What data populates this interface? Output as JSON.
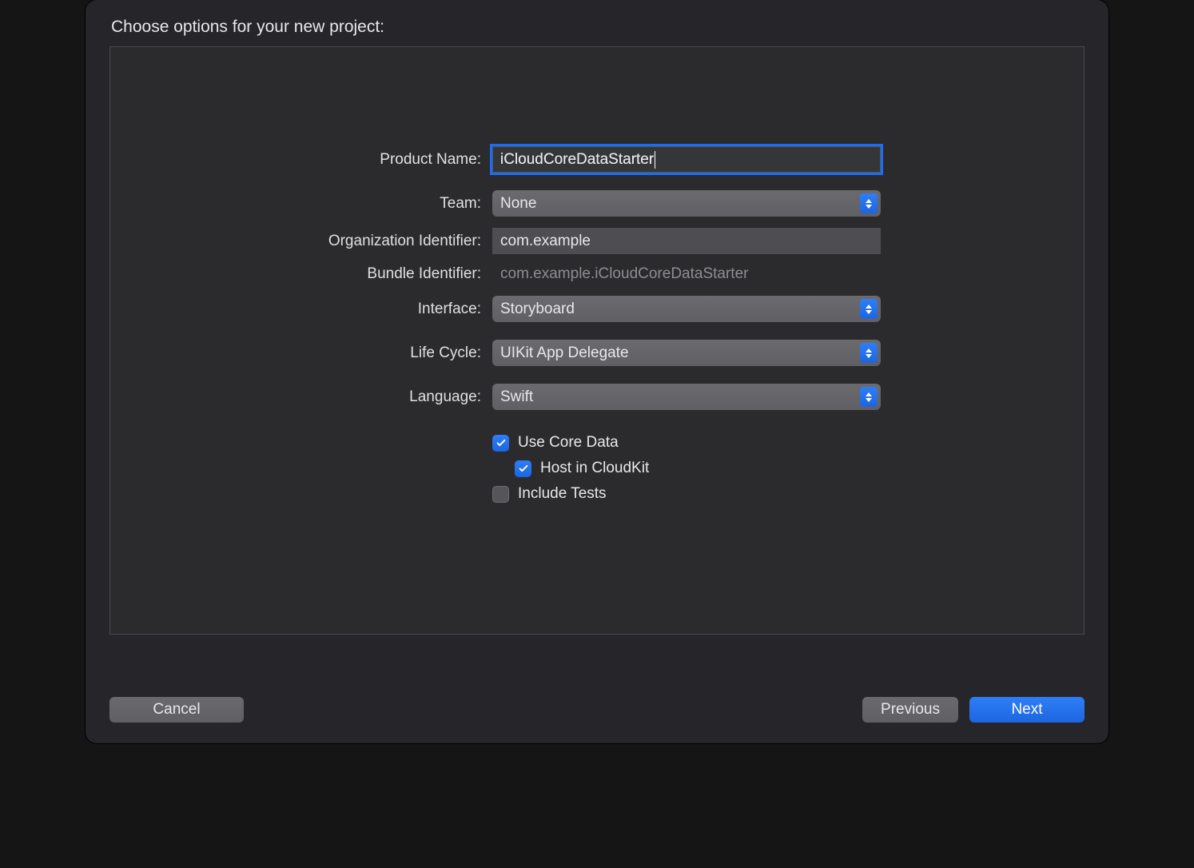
{
  "heading": "Choose options for your new project:",
  "fields": {
    "product_name": {
      "label": "Product Name:",
      "value": "iCloudCoreDataStarter"
    },
    "team": {
      "label": "Team:",
      "value": "None"
    },
    "org_identifier": {
      "label": "Organization Identifier:",
      "value": "com.example"
    },
    "bundle_identifier": {
      "label": "Bundle Identifier:",
      "value": "com.example.iCloudCoreDataStarter"
    },
    "interface": {
      "label": "Interface:",
      "value": "Storyboard"
    },
    "life_cycle": {
      "label": "Life Cycle:",
      "value": "UIKit App Delegate"
    },
    "language": {
      "label": "Language:",
      "value": "Swift"
    }
  },
  "checkboxes": {
    "use_core_data": {
      "label": "Use Core Data",
      "checked": true,
      "indent": 0
    },
    "host_cloudkit": {
      "label": "Host in CloudKit",
      "checked": true,
      "indent": 1
    },
    "include_tests": {
      "label": "Include Tests",
      "checked": false,
      "indent": 0
    }
  },
  "buttons": {
    "cancel": "Cancel",
    "previous": "Previous",
    "next": "Next"
  }
}
